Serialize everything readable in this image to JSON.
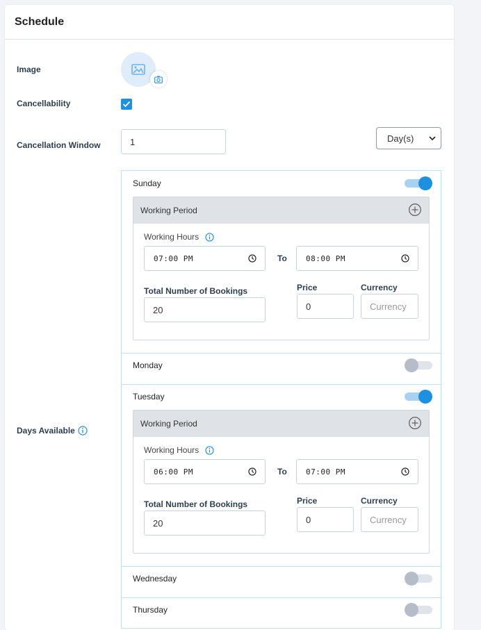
{
  "header": {
    "title": "Schedule"
  },
  "form": {
    "image_label": "Image",
    "cancellability_label": "Cancellability",
    "cancellable": true,
    "cancellation_window_label": "Cancellation Window",
    "cancellation_window_value": "1",
    "cancellation_unit": "Day(s)",
    "days_available_label": "Days Available"
  },
  "days": [
    {
      "name": "Sunday",
      "enabled": true,
      "period": {
        "title": "Working Period",
        "hours_label": "Working Hours",
        "from": "07:00 PM",
        "to_label": "To",
        "to": "08:00 PM",
        "bookings_label": "Total Number of Bookings",
        "bookings": "20",
        "price_label": "Price",
        "price": "0",
        "currency_label": "Currency",
        "currency_placeholder": "Currency"
      }
    },
    {
      "name": "Monday",
      "enabled": false
    },
    {
      "name": "Tuesday",
      "enabled": true,
      "period": {
        "title": "Working Period",
        "hours_label": "Working Hours",
        "from": "06:00 PM",
        "to_label": "To",
        "to": "07:00 PM",
        "bookings_label": "Total Number of Bookings",
        "bookings": "20",
        "price_label": "Price",
        "price": "0",
        "currency_label": "Currency",
        "currency_placeholder": "Currency"
      }
    },
    {
      "name": "Wednesday",
      "enabled": false
    },
    {
      "name": "Thursday",
      "enabled": false
    }
  ],
  "colors": {
    "accent": "#1e90e0",
    "border": "#bfe0f0"
  }
}
